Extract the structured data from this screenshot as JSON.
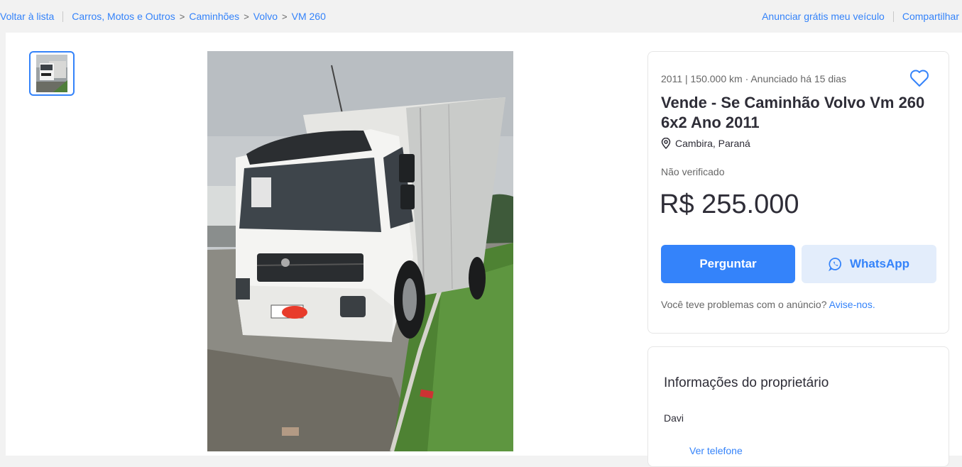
{
  "topbar": {
    "back_link": "Voltar à lista",
    "breadcrumb": [
      "Carros, Motos e Outros",
      "Caminhões",
      "Volvo",
      "VM 260"
    ],
    "sell_link": "Anunciar grátis meu veículo",
    "share_link": "Compartilhar"
  },
  "listing": {
    "meta": "2011 | 150.000 km · Anunciado há 15 dias",
    "title": "Vende - Se Caminhão Volvo Vm 260 6x2 Ano 2011",
    "location": "Cambira, Paraná",
    "verification": "Não verificado",
    "price": "R$ 255.000",
    "ask_button": "Perguntar",
    "whatsapp_button": "WhatsApp",
    "problem_text": "Você teve problemas com o anúncio?",
    "problem_link": "Avise-nos."
  },
  "owner": {
    "heading": "Informações do proprietário",
    "name": "Davi",
    "phone_link": "Ver telefone"
  },
  "icons": {
    "heart": "heart-icon",
    "location": "map-pin-icon",
    "whatsapp": "whatsapp-icon"
  },
  "colors": {
    "accent": "#3483fa",
    "accent_light": "#e3edfb",
    "text": "#2e2d37"
  }
}
